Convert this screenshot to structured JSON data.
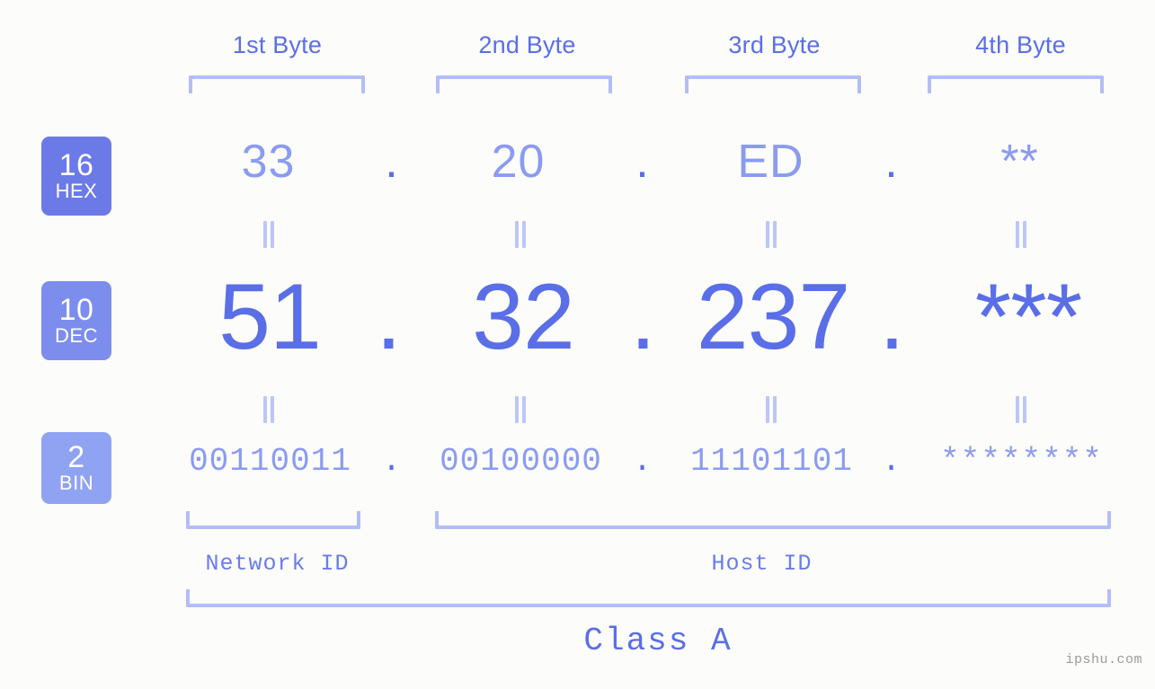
{
  "meta": {
    "background_color": "#fcfdfa",
    "accent_color": "#5a6ee8",
    "muted_accent_color": "#8b9bf2",
    "bracket_color": "#b3bdf7"
  },
  "byte_headers": [
    {
      "label": "1st Byte"
    },
    {
      "label": "2nd Byte"
    },
    {
      "label": "3rd Byte"
    },
    {
      "label": "4th Byte"
    }
  ],
  "radix_badges": [
    {
      "number": "16",
      "name": "HEX",
      "color": "#6c7ae8"
    },
    {
      "number": "10",
      "name": "DEC",
      "color": "#7d8ded"
    },
    {
      "number": "2",
      "name": "BIN",
      "color": "#90a3f2"
    }
  ],
  "rows": {
    "hex": {
      "values": [
        "33",
        "20",
        "ED",
        "**"
      ],
      "separator": "."
    },
    "dec": {
      "values": [
        "51",
        "32",
        "237",
        "***"
      ],
      "separator": "."
    },
    "bin": {
      "values": [
        "00110011",
        "00100000",
        "11101101",
        "********"
      ],
      "separator": "."
    }
  },
  "connector_symbol": "=",
  "id_sections": [
    {
      "label": "Network ID"
    },
    {
      "label": "Host ID"
    }
  ],
  "class": {
    "label": "Class A"
  },
  "watermark": {
    "text": "ipshu.com"
  }
}
